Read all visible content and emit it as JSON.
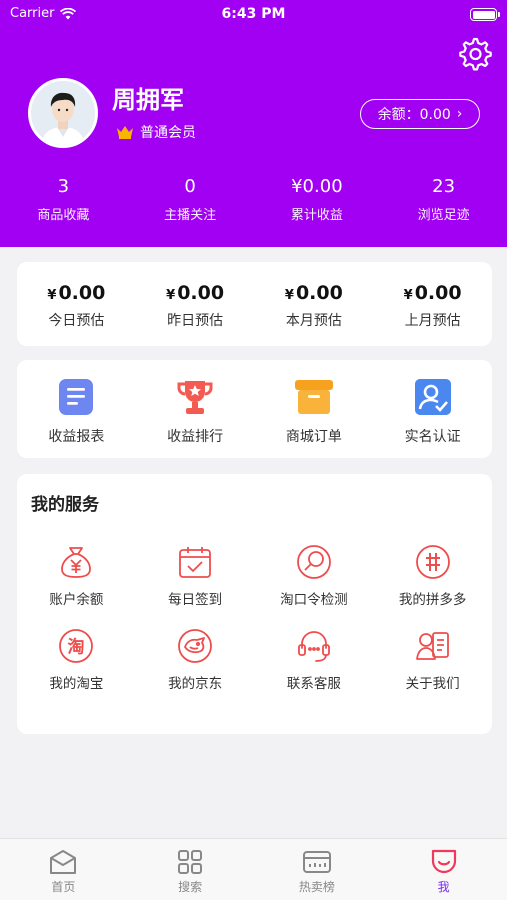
{
  "status_bar": {
    "carrier": "Carrier",
    "time": "6:43 PM"
  },
  "profile": {
    "name": "周拥军",
    "member_level": "普通会员",
    "balance_label": "余额：0.00",
    "balance_chevron": "›"
  },
  "stats": [
    {
      "value": "3",
      "label": "商品收藏"
    },
    {
      "value": "0",
      "label": "主播关注"
    },
    {
      "value": "¥0.00",
      "label": "累计收益"
    },
    {
      "value": "23",
      "label": "浏览足迹"
    }
  ],
  "estimates": [
    {
      "currency": "¥",
      "amount": "0.00",
      "label": "今日预估"
    },
    {
      "currency": "¥",
      "amount": "0.00",
      "label": "昨日预估"
    },
    {
      "currency": "¥",
      "amount": "0.00",
      "label": "本月预估"
    },
    {
      "currency": "¥",
      "amount": "0.00",
      "label": "上月预估"
    }
  ],
  "quick_actions": [
    {
      "label": "收益报表",
      "icon": "report-icon",
      "color": "#6e87f0"
    },
    {
      "label": "收益排行",
      "icon": "trophy-icon",
      "color": "#f25a52"
    },
    {
      "label": "商城订单",
      "icon": "box-icon",
      "color": "#f7a21e"
    },
    {
      "label": "实名认证",
      "icon": "id-verify-icon",
      "color": "#4a88f0"
    }
  ],
  "services": {
    "title": "我的服务",
    "accent": "#ee4d4d",
    "items": [
      {
        "label": "账户余额",
        "icon": "money-bag-icon"
      },
      {
        "label": "每日签到",
        "icon": "calendar-check-icon"
      },
      {
        "label": "淘口令检测",
        "icon": "magnifier-icon"
      },
      {
        "label": "我的拼多多",
        "icon": "pinduoduo-icon",
        "glyph": "拼"
      },
      {
        "label": "我的淘宝",
        "icon": "taobao-icon",
        "glyph": "淘"
      },
      {
        "label": "我的京东",
        "icon": "jd-dog-icon"
      },
      {
        "label": "联系客服",
        "icon": "headset-icon"
      },
      {
        "label": "关于我们",
        "icon": "about-card-icon"
      }
    ]
  },
  "tabbar": [
    {
      "label": "首页",
      "icon": "home-icon",
      "active": false
    },
    {
      "label": "搜索",
      "icon": "grid-icon",
      "active": false
    },
    {
      "label": "热卖榜",
      "icon": "ranking-icon",
      "active": false
    },
    {
      "label": "我",
      "icon": "me-icon",
      "active": true
    }
  ],
  "colors": {
    "header": "#a100f2",
    "tab_active": "#7b2cf0",
    "service_red": "#ee4d4d"
  }
}
